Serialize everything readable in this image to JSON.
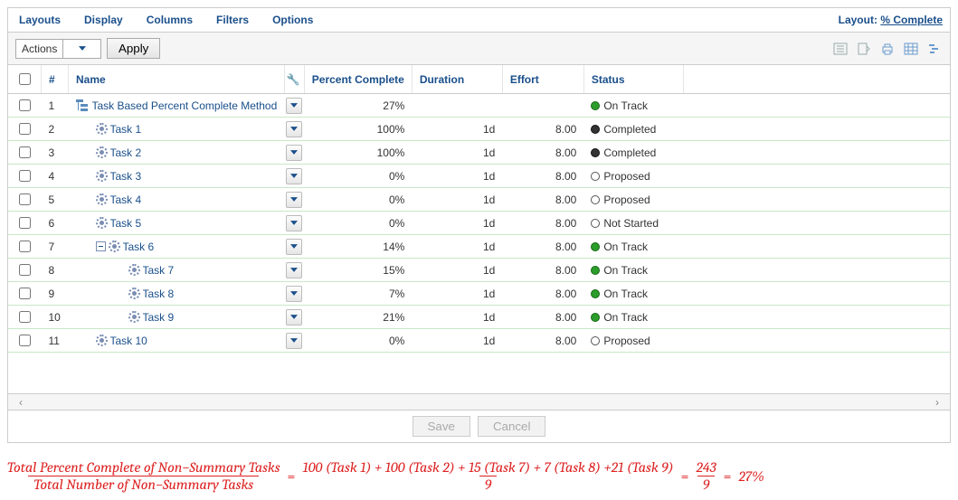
{
  "menu": {
    "items": [
      "Layouts",
      "Display",
      "Columns",
      "Filters",
      "Options"
    ],
    "layoutLabel": "Layout:",
    "layoutName": "% Complete"
  },
  "toolbar": {
    "actions": "Actions",
    "apply": "Apply"
  },
  "header": {
    "num": "#",
    "name": "Name",
    "pct": "Percent Complete",
    "dur": "Duration",
    "eff": "Effort",
    "status": "Status"
  },
  "rows": [
    {
      "num": "1",
      "indent": 0,
      "icon": "hier",
      "name": "Task Based Percent Complete Method",
      "pct": "27%",
      "dur": "",
      "eff": "",
      "status": "On Track",
      "dot": "green"
    },
    {
      "num": "2",
      "indent": 1,
      "icon": "gear",
      "name": "Task 1",
      "pct": "100%",
      "dur": "1d",
      "eff": "8.00",
      "status": "Completed",
      "dot": "black"
    },
    {
      "num": "3",
      "indent": 1,
      "icon": "gear",
      "name": "Task 2",
      "pct": "100%",
      "dur": "1d",
      "eff": "8.00",
      "status": "Completed",
      "dot": "black"
    },
    {
      "num": "4",
      "indent": 1,
      "icon": "gear",
      "name": "Task 3",
      "pct": "0%",
      "dur": "1d",
      "eff": "8.00",
      "status": "Proposed",
      "dot": "white"
    },
    {
      "num": "5",
      "indent": 1,
      "icon": "gear",
      "name": "Task 4",
      "pct": "0%",
      "dur": "1d",
      "eff": "8.00",
      "status": "Proposed",
      "dot": "white"
    },
    {
      "num": "6",
      "indent": 1,
      "icon": "gear",
      "name": "Task 5",
      "pct": "0%",
      "dur": "1d",
      "eff": "8.00",
      "status": "Not Started",
      "dot": "white"
    },
    {
      "num": "7",
      "indent": 1,
      "icon": "gear",
      "expander": true,
      "name": "Task 6",
      "pct": "14%",
      "dur": "1d",
      "eff": "8.00",
      "status": "On Track",
      "dot": "green"
    },
    {
      "num": "8",
      "indent": 2,
      "icon": "gear",
      "name": "Task 7",
      "pct": "15%",
      "dur": "1d",
      "eff": "8.00",
      "status": "On Track",
      "dot": "green"
    },
    {
      "num": "9",
      "indent": 2,
      "icon": "gear",
      "name": "Task 8",
      "pct": "7%",
      "dur": "1d",
      "eff": "8.00",
      "status": "On Track",
      "dot": "green"
    },
    {
      "num": "10",
      "indent": 2,
      "icon": "gear",
      "name": "Task 9",
      "pct": "21%",
      "dur": "1d",
      "eff": "8.00",
      "status": "On Track",
      "dot": "green"
    },
    {
      "num": "11",
      "indent": 1,
      "icon": "gear",
      "name": "Task 10",
      "pct": "0%",
      "dur": "1d",
      "eff": "8.00",
      "status": "Proposed",
      "dot": "white"
    }
  ],
  "footer": {
    "save": "Save",
    "cancel": "Cancel"
  },
  "formula": {
    "leftTop": "Total Percent Complete of Non−Summary Tasks",
    "leftBot": "Total Number of Non−Summary Tasks",
    "midTop": "100 (Task 1) + 100 (Task 2) + 15 (Task 7) + 7 (Task 8) +21 (Task 9)",
    "midBot": "9",
    "rightTop": "243",
    "rightBot": "9",
    "result": "27%"
  }
}
